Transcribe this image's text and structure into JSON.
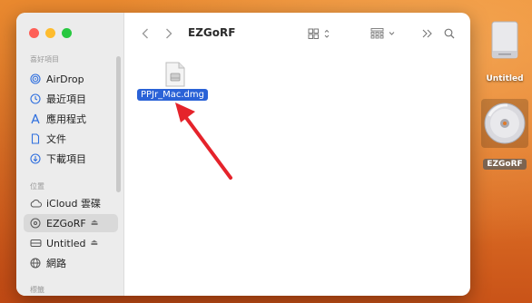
{
  "window": {
    "title": "EZGoRF"
  },
  "sidebar": {
    "favorites_header": "喜好項目",
    "favorites": [
      {
        "label": "AirDrop",
        "icon": "airdrop-icon"
      },
      {
        "label": "最近項目",
        "icon": "clock-icon"
      },
      {
        "label": "應用程式",
        "icon": "applications-icon"
      },
      {
        "label": "文件",
        "icon": "document-icon"
      },
      {
        "label": "下載項目",
        "icon": "download-icon"
      }
    ],
    "locations_header": "位置",
    "locations": [
      {
        "label": "iCloud 雲碟",
        "icon": "cloud-icon",
        "selected": false,
        "eject": false
      },
      {
        "label": "EZGoRF",
        "icon": "disk-image-icon",
        "selected": true,
        "eject": true
      },
      {
        "label": "Untitled",
        "icon": "drive-icon",
        "selected": false,
        "eject": true
      },
      {
        "label": "網路",
        "icon": "network-icon",
        "selected": false,
        "eject": false
      }
    ],
    "tags_header": "標籤"
  },
  "content": {
    "files": [
      {
        "name": "PPJr_Mac.dmg",
        "icon": "dmg-file-icon",
        "selected": true
      }
    ]
  },
  "desktop": {
    "items": [
      {
        "label": "Untitled",
        "icon": "external-drive-icon"
      },
      {
        "label": "EZGoRF",
        "icon": "cd-disc-icon",
        "selected": true
      }
    ]
  },
  "annotation": {
    "type": "arrow",
    "color": "#e5232b"
  },
  "colors": {
    "selection_blue": "#2a62d7",
    "wallpaper": "#e07a2a"
  }
}
